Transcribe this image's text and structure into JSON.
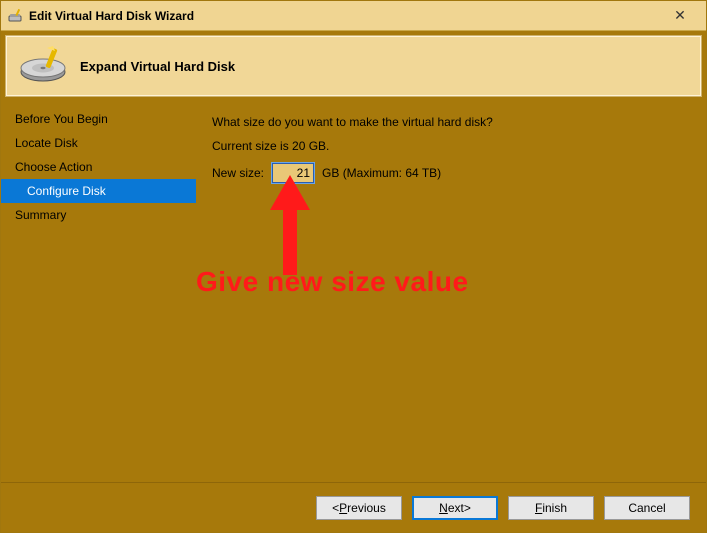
{
  "window": {
    "title": "Edit Virtual Hard Disk Wizard",
    "close_glyph": "✕"
  },
  "header": {
    "heading": "Expand Virtual Hard Disk"
  },
  "sidebar": {
    "steps": [
      {
        "label": "Before You Begin",
        "selected": false
      },
      {
        "label": "Locate Disk",
        "selected": false
      },
      {
        "label": "Choose Action",
        "selected": false
      },
      {
        "label": "Configure Disk",
        "selected": true
      },
      {
        "label": "Summary",
        "selected": false
      }
    ]
  },
  "content": {
    "prompt": "What size do you want to make the virtual hard disk?",
    "current_size_text": "Current size is 20 GB.",
    "new_size_label": "New size:",
    "new_size_value": "21",
    "new_size_suffix": "GB (Maximum: 64 TB)"
  },
  "annotation": {
    "text": "Give new size value"
  },
  "buttons": {
    "previous": "Previous",
    "previous_prefix": "< ",
    "next": "Next",
    "next_suffix": " >",
    "finish": "Finish",
    "cancel": "Cancel"
  }
}
